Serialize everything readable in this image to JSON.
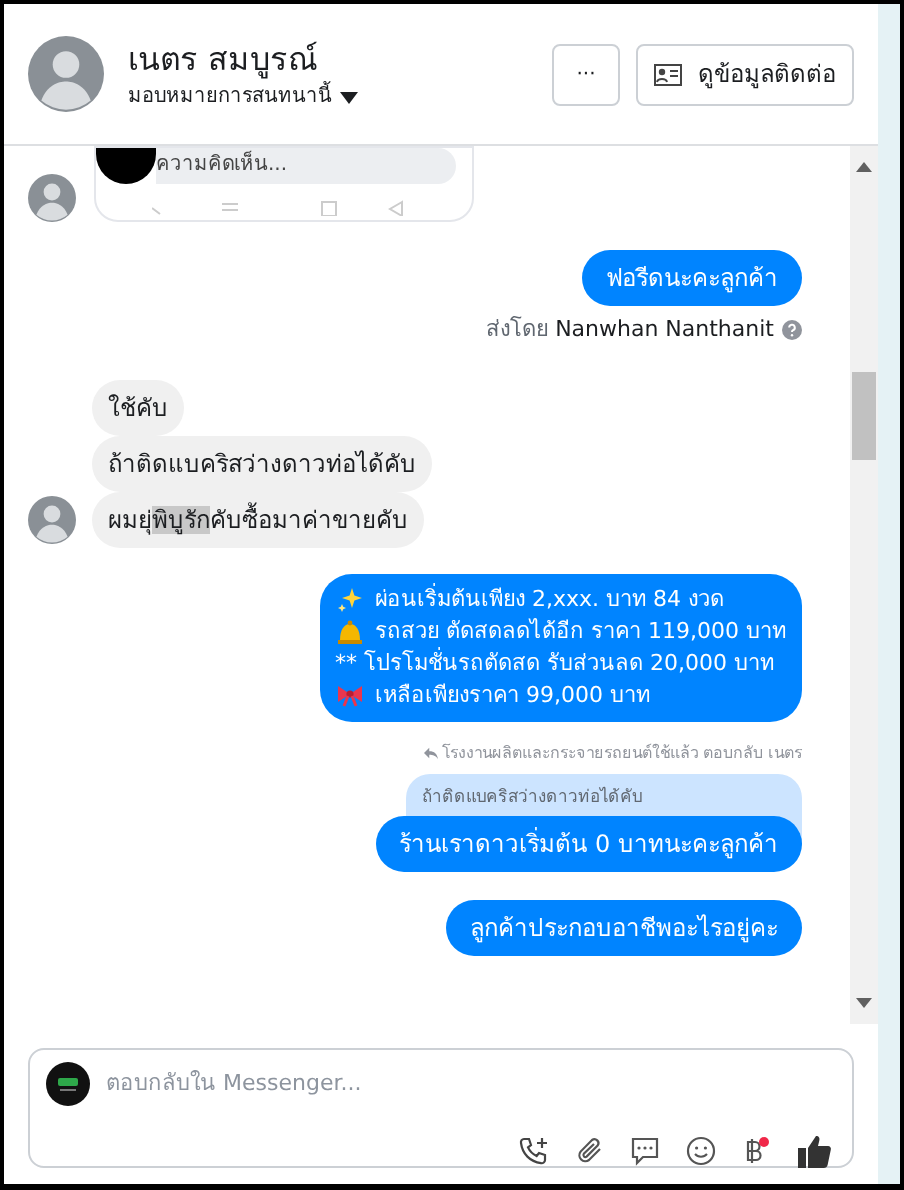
{
  "header": {
    "name": "เนตร สมบูรณ์",
    "assign": "มอบหมายการสนทนานี้",
    "more_button": "···",
    "contact_button": "ดูข้อมูลติดต่อ"
  },
  "preview": {
    "text": "ความคิดเห็น..."
  },
  "messages": [
    {
      "kind": "outgoing",
      "text": "ฟอรีดนะคะลูกค้า"
    },
    {
      "kind": "sent_by",
      "prefix": "ส่งโดย",
      "name": "Nanwhan Nanthanit"
    },
    {
      "kind": "incoming",
      "parts": [
        {
          "text": "ใช้คับ",
          "selected": false
        }
      ],
      "avatar": false
    },
    {
      "kind": "incoming",
      "parts": [
        {
          "text": "ถ้าติดแบคริสว่างดาวท่อได้คับ",
          "selected": false
        }
      ],
      "avatar": false
    },
    {
      "kind": "incoming",
      "parts": [
        {
          "text": "ผมยุ่",
          "selected": false
        },
        {
          "text": "พิบูรัก",
          "selected": true
        },
        {
          "text": "คับซื้อมาค่าขายคับ",
          "selected": false
        }
      ],
      "avatar": true
    },
    {
      "kind": "promo",
      "lines": [
        {
          "kind": "sparkle",
          "text": "ผ่อนเริ่มต้นเพียง 2,xxx. บาท 84 งวด"
        },
        {
          "kind": "bell",
          "text": "รถสวย ตัดสดลดได้อีก ราคา  119,000 บาท"
        },
        {
          "kind": "plain",
          "text": "** โปรโมชั่นรถตัดสด รับส่วนลด 20,000 บาท"
        },
        {
          "kind": "bow",
          "text": "เหลือเพียงราคา 99,000 บาท"
        }
      ]
    },
    {
      "kind": "reply",
      "note": "โรงงานผลิตและกระจายรถยนต์ใช้แล้ว ตอบกลับ เนตร",
      "quote": "ถ้าติดแบคริสว่างดาวท่อได้คับ",
      "text": "ร้านเราดาวเริ่มต้น 0 บาทนะคะลูกค้า"
    },
    {
      "kind": "outgoing",
      "text": "ลูกค้าประกอบอาชีพอะไรอยู่คะ"
    }
  ],
  "composer": {
    "placeholder": "ตอบกลับใน Messenger..."
  }
}
